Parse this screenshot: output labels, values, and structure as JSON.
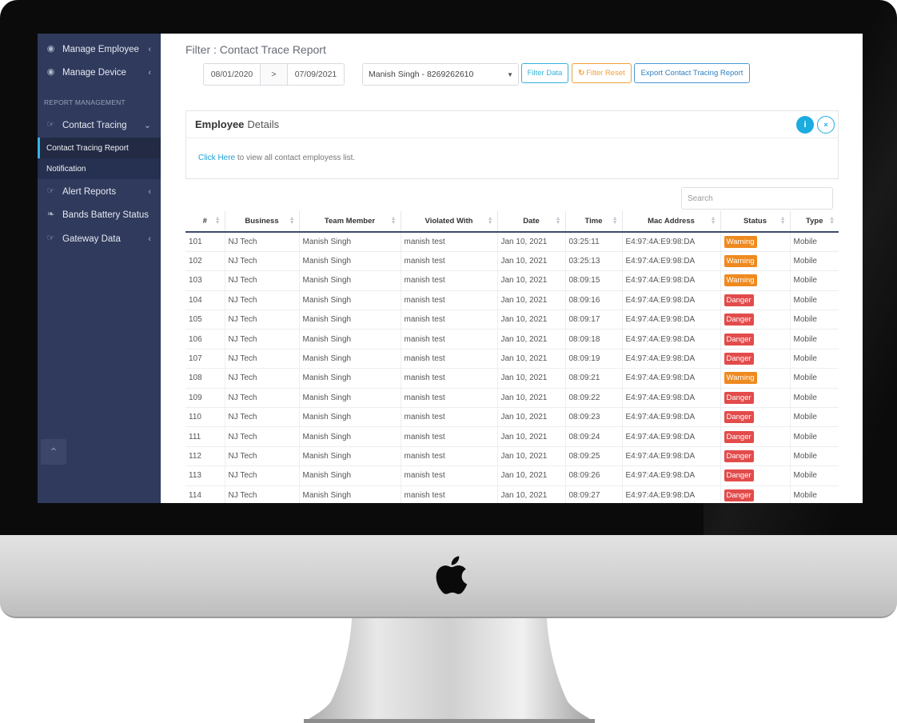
{
  "sidebar": {
    "items": [
      {
        "label": "Manage Employee",
        "icon": "award-icon"
      },
      {
        "label": "Manage Device",
        "icon": "award-icon"
      }
    ],
    "section_label": "REPORT MANAGEMENT",
    "contact_tracing": {
      "label": "Contact Tracing",
      "icon": "hand-point-icon"
    },
    "sub_items": [
      {
        "label": "Contact Tracing Report",
        "active": true
      },
      {
        "label": "Notification",
        "active": false
      }
    ],
    "bottom_items": [
      {
        "label": "Alert Reports",
        "icon": "hand-point-icon"
      },
      {
        "label": "Bands Battery Status",
        "icon": "leaf-icon"
      },
      {
        "label": "Gateway Data",
        "icon": "hand-point-icon"
      }
    ]
  },
  "filter": {
    "title": "Filter : Contact Trace Report",
    "date_from": "08/01/2020",
    "date_sep": ">",
    "date_to": "07/09/2021",
    "employee_select": "Manish Singh - 8269262610",
    "filter_button": "Filter Data",
    "reset_button": "Filter Reset",
    "export_button": "Export Contact Tracing Report"
  },
  "panel": {
    "title_bold": "Employee",
    "title_rest": "Details",
    "info_label": "i",
    "close_label": "×",
    "link_text": "Click Here",
    "body_text": " to view all contact employess list."
  },
  "search": {
    "placeholder": "Search"
  },
  "table": {
    "columns": [
      "#",
      "Business",
      "Team Member",
      "Violated With",
      "Date",
      "Time",
      "Mac Address",
      "Status",
      "Type"
    ],
    "rows": [
      [
        "101",
        "NJ Tech",
        "Manish Singh",
        "manish test",
        "Jan 10, 2021",
        "03:25:11",
        "E4:97:4A:E9:98:DA",
        "Warning",
        "Mobile"
      ],
      [
        "102",
        "NJ Tech",
        "Manish Singh",
        "manish test",
        "Jan 10, 2021",
        "03:25:13",
        "E4:97:4A:E9:98:DA",
        "Warning",
        "Mobile"
      ],
      [
        "103",
        "NJ Tech",
        "Manish Singh",
        "manish test",
        "Jan 10, 2021",
        "08:09:15",
        "E4:97:4A:E9:98:DA",
        "Warning",
        "Mobile"
      ],
      [
        "104",
        "NJ Tech",
        "Manish Singh",
        "manish test",
        "Jan 10, 2021",
        "08:09:16",
        "E4:97:4A:E9:98:DA",
        "Danger",
        "Mobile"
      ],
      [
        "105",
        "NJ Tech",
        "Manish Singh",
        "manish test",
        "Jan 10, 2021",
        "08:09:17",
        "E4:97:4A:E9:98:DA",
        "Danger",
        "Mobile"
      ],
      [
        "106",
        "NJ Tech",
        "Manish Singh",
        "manish test",
        "Jan 10, 2021",
        "08:09:18",
        "E4:97:4A:E9:98:DA",
        "Danger",
        "Mobile"
      ],
      [
        "107",
        "NJ Tech",
        "Manish Singh",
        "manish test",
        "Jan 10, 2021",
        "08:09:19",
        "E4:97:4A:E9:98:DA",
        "Danger",
        "Mobile"
      ],
      [
        "108",
        "NJ Tech",
        "Manish Singh",
        "manish test",
        "Jan 10, 2021",
        "08:09:21",
        "E4:97:4A:E9:98:DA",
        "Warning",
        "Mobile"
      ],
      [
        "109",
        "NJ Tech",
        "Manish Singh",
        "manish test",
        "Jan 10, 2021",
        "08:09:22",
        "E4:97:4A:E9:98:DA",
        "Danger",
        "Mobile"
      ],
      [
        "110",
        "NJ Tech",
        "Manish Singh",
        "manish test",
        "Jan 10, 2021",
        "08:09:23",
        "E4:97:4A:E9:98:DA",
        "Danger",
        "Mobile"
      ],
      [
        "111",
        "NJ Tech",
        "Manish Singh",
        "manish test",
        "Jan 10, 2021",
        "08:09:24",
        "E4:97:4A:E9:98:DA",
        "Danger",
        "Mobile"
      ],
      [
        "112",
        "NJ Tech",
        "Manish Singh",
        "manish test",
        "Jan 10, 2021",
        "08:09:25",
        "E4:97:4A:E9:98:DA",
        "Danger",
        "Mobile"
      ],
      [
        "113",
        "NJ Tech",
        "Manish Singh",
        "manish test",
        "Jan 10, 2021",
        "08:09:26",
        "E4:97:4A:E9:98:DA",
        "Danger",
        "Mobile"
      ],
      [
        "114",
        "NJ Tech",
        "Manish Singh",
        "manish test",
        "Jan 10, 2021",
        "08:09:27",
        "E4:97:4A:E9:98:DA",
        "Danger",
        "Mobile"
      ]
    ]
  },
  "colors": {
    "sidebar_bg": "#2f3a5c",
    "accent": "#1bace0",
    "warning": "#ef8a1f",
    "danger": "#e34b4b"
  }
}
